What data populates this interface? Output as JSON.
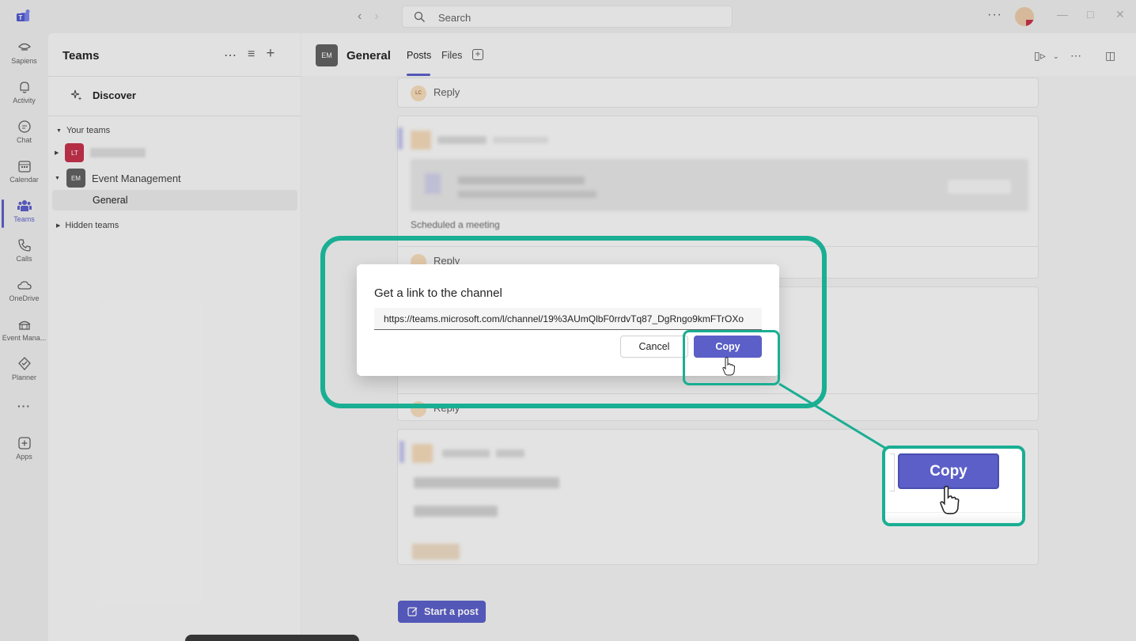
{
  "titlebar": {
    "search_placeholder": "Search",
    "more": "···"
  },
  "rail": {
    "items": [
      {
        "label": "Sapiens",
        "icon": "sapiens-icon"
      },
      {
        "label": "Activity",
        "icon": "bell-icon"
      },
      {
        "label": "Chat",
        "icon": "chat-icon"
      },
      {
        "label": "Calendar",
        "icon": "calendar-icon"
      },
      {
        "label": "Teams",
        "icon": "teams-icon"
      },
      {
        "label": "Calls",
        "icon": "phone-icon"
      },
      {
        "label": "OneDrive",
        "icon": "cloud-icon"
      },
      {
        "label": "Event Mana...",
        "icon": "event-icon"
      },
      {
        "label": "Planner",
        "icon": "planner-icon"
      },
      {
        "label": "···",
        "icon": "more-icon"
      },
      {
        "label": "Apps",
        "icon": "apps-icon"
      }
    ]
  },
  "teams_panel": {
    "title": "Teams",
    "discover": "Discover",
    "your_teams": "Your teams",
    "teams": [
      {
        "avatar": "LT",
        "name": "",
        "color": "#c4314b"
      },
      {
        "avatar": "EM",
        "name": "Event Management",
        "color": "#616161"
      }
    ],
    "channel": "General",
    "hidden_teams": "Hidden teams"
  },
  "channel_header": {
    "avatar": "EM",
    "title": "General",
    "tabs": [
      "Posts",
      "Files"
    ]
  },
  "feed": {
    "reply_label": "Reply",
    "reply_avatar": "LC",
    "scheduled_text": "Scheduled a meeting",
    "start_post": "Start a post"
  },
  "dialog": {
    "title": "Get a link to the channel",
    "link": "https://teams.microsoft.com/l/channel/19%3AUmQlbF0rrdvTq87_DgRngo9kmFTrOXo",
    "cancel": "Cancel",
    "copy": "Copy"
  },
  "callout": {
    "copy": "Copy"
  },
  "colors": {
    "accent": "#5b5fc7",
    "highlight": "#1aae93"
  }
}
